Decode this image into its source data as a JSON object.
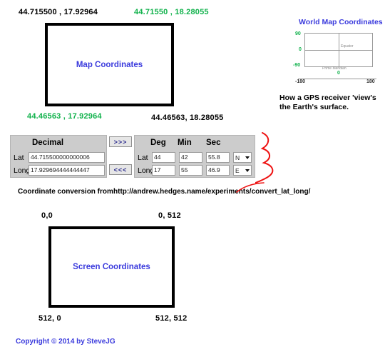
{
  "map_section": {
    "box_label": "Map Coordinates",
    "corners": {
      "top_left": "44.715500 , 17.92964",
      "top_right": "44.71550 , 18.28055",
      "bottom_left": "44.46563 , 17.92964",
      "bottom_right": "44.46563, 18.28055"
    }
  },
  "world_map": {
    "title": "World Map Coordinates",
    "caption": "How a GPS receiver 'view's the Earth's surface.",
    "y_ticks": [
      "90",
      "0",
      "-90"
    ],
    "x_ticks": [
      "-180",
      "180"
    ],
    "x_center_tick": "0",
    "inner_labels": {
      "equator": "Equator",
      "prime_meridian": "Prime Meridian"
    }
  },
  "converter": {
    "decimal_panel": {
      "header": "Decimal",
      "rows": [
        {
          "label": "Lat",
          "value": "44.715500000000006"
        },
        {
          "label": "Long",
          "value": "17.929694444444447"
        }
      ]
    },
    "buttons": {
      "to_dms": ">>>",
      "to_decimal": "<<<"
    },
    "dms_panel": {
      "headers": [
        "Deg",
        "Min",
        "Sec"
      ],
      "rows": [
        {
          "label": "Lat",
          "deg": "44",
          "min": "42",
          "sec": "55.8",
          "hemisphere": "N"
        },
        {
          "label": "Long",
          "deg": "17",
          "min": "55",
          "sec": "46.9",
          "hemisphere": "E"
        }
      ]
    },
    "source_label": "Coordinate conversion from:",
    "source_url": "http://andrew.hedges.name/experiments/convert_lat_long/"
  },
  "screen_section": {
    "box_label": "Screen Coordinates",
    "corners": {
      "top_left": "0,0",
      "top_right": "0, 512",
      "bottom_left": "512, 0",
      "bottom_right": "512, 512"
    }
  },
  "footer": {
    "copyright": "Copyright  ©  2014 by  SteveJG"
  },
  "colors": {
    "green": "#11b24c",
    "blue": "#3b3bdd",
    "black": "#000000",
    "panel_gray": "#cccccc",
    "red_annotation": "#ee1111"
  }
}
